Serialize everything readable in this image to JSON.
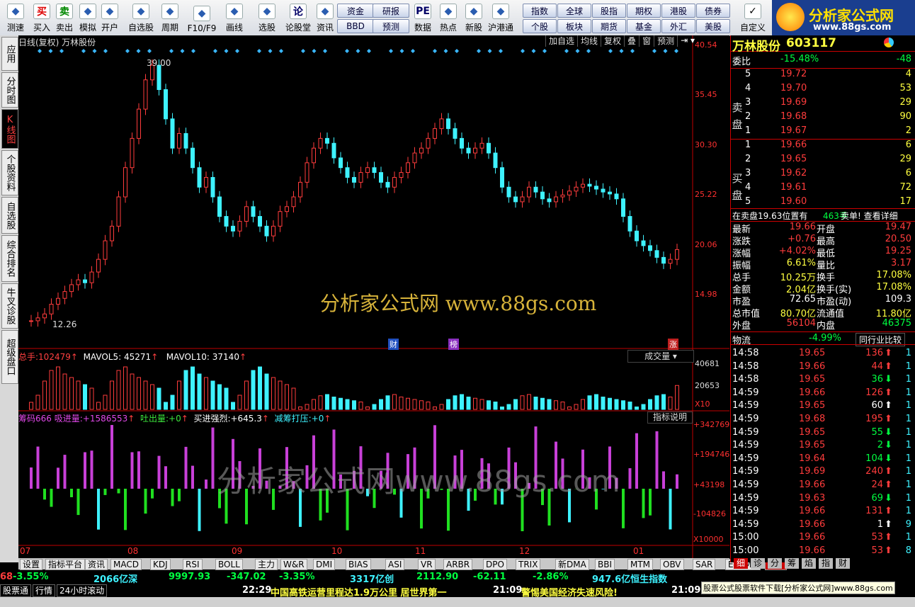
{
  "toolbar": {
    "buttons": [
      {
        "label": "测速",
        "icon": "clock-icon"
      },
      {
        "label": "买入",
        "icon": "buy-icon",
        "glyph": "买"
      },
      {
        "label": "卖出",
        "icon": "sell-icon",
        "glyph": "卖"
      },
      {
        "label": "模拟",
        "icon": "hammer-icon"
      },
      {
        "label": "开户",
        "icon": "lock-icon"
      },
      {
        "label": "自选股",
        "icon": "star-icon"
      },
      {
        "label": "周期",
        "icon": "cycle-icon"
      },
      {
        "label": "F10/F9",
        "icon": "f10-icon"
      },
      {
        "label": "画线",
        "icon": "pencil-icon"
      },
      {
        "label": "选股",
        "icon": "picker-icon"
      },
      {
        "label": "论股堂",
        "icon": "discuss-icon",
        "glyph": "论"
      },
      {
        "label": "资讯",
        "icon": "news-icon"
      },
      {
        "label": "数据",
        "icon": "pe-icon",
        "glyph": "PE"
      },
      {
        "label": "热点",
        "icon": "hot-icon"
      },
      {
        "label": "新股",
        "icon": "ipo-icon"
      },
      {
        "label": "沪港通",
        "icon": "hk-icon"
      }
    ],
    "quick_left": [
      "资金",
      "研报",
      "BBD",
      "预测"
    ],
    "quick_right": [
      "指数",
      "全球",
      "股指",
      "期权",
      "港股",
      "债券",
      "个股",
      "板块",
      "期货",
      "基金",
      "外汇",
      "美股"
    ],
    "custom_label": "自定义",
    "logo_text": "分析家公式网",
    "logo_url": "www.88gs.com"
  },
  "left_tabs": [
    "应用",
    "分时图",
    "K线图",
    "个股资料",
    "自选股",
    "综合排名",
    "牛叉诊股",
    "超级盘口"
  ],
  "chart": {
    "title": "日线(复权)  万林股份",
    "top_buttons": [
      "加自选",
      "均线",
      "复权",
      "叠",
      "窗",
      "预测"
    ],
    "price_axis": [
      "40.54",
      "35.45",
      "30.30",
      "25.22",
      "20.06",
      "14.98"
    ],
    "high_label": "39.00",
    "low_label": "12.26",
    "watermark": "分析家公式网  www.88gs.com",
    "markers": [
      "财",
      "榜",
      "涨"
    ],
    "vol_header": {
      "zs_label": "总手:",
      "zs_value": "102479",
      "ma5_label": "MAVOL5:",
      "ma5_value": "45271",
      "ma10_label": "MAVOL10:",
      "ma10_value": "37140"
    },
    "vol_dropdown": "成交量",
    "vol_axis": [
      "40681",
      "20653",
      "X10"
    ],
    "ind_header": {
      "name": "筹码666",
      "a_label": "吸进量:",
      "a_value": "+1586553",
      "b_label": "吐出量:",
      "b_value": "+0",
      "c_label": "买进强烈:",
      "c_value": "+645.3",
      "d_label": "减筹打压:",
      "d_value": "+0"
    },
    "ind_button": "指标说明",
    "ind_axis": [
      "+342769",
      "+194746",
      "+43198",
      "-104826",
      "X10000"
    ],
    "ind_watermark": "分析家公式网www.88gs.com",
    "month_labels": [
      "07",
      "08",
      "09",
      "10",
      "11",
      "12",
      "01"
    ]
  },
  "quote": {
    "name": "万林股份",
    "code": "603117",
    "weibi_label": "委比",
    "weibi_value": "-15.48%",
    "weicha_value": "-48",
    "sell_label": "卖盘",
    "buy_label": "买盘",
    "sell": [
      {
        "lvl": "5",
        "price": "19.72",
        "vol": "4"
      },
      {
        "lvl": "4",
        "price": "19.70",
        "vol": "53"
      },
      {
        "lvl": "3",
        "price": "19.69",
        "vol": "29"
      },
      {
        "lvl": "2",
        "price": "19.68",
        "vol": "90"
      },
      {
        "lvl": "1",
        "price": "19.67",
        "vol": "2"
      }
    ],
    "buy": [
      {
        "lvl": "1",
        "price": "19.66",
        "vol": "6"
      },
      {
        "lvl": "2",
        "price": "19.65",
        "vol": "29"
      },
      {
        "lvl": "3",
        "price": "19.62",
        "vol": "6"
      },
      {
        "lvl": "4",
        "price": "19.61",
        "vol": "72"
      },
      {
        "lvl": "5",
        "price": "19.60",
        "vol": "17"
      }
    ],
    "pos_text_a": "在卖盘19.63位置有",
    "pos_vol": "463手",
    "pos_text_b": "卖单! 查看详细",
    "stats": [
      {
        "l1": "最新",
        "v1": "19.66",
        "c1": "red",
        "l2": "开盘",
        "v2": "19.47",
        "c2": "red"
      },
      {
        "l1": "涨跌",
        "v1": "+0.76",
        "c1": "red",
        "l2": "最高",
        "v2": "20.50",
        "c2": "red"
      },
      {
        "l1": "涨幅",
        "v1": "+4.02%",
        "c1": "red",
        "l2": "最低",
        "v2": "19.25",
        "c2": "red"
      },
      {
        "l1": "振幅",
        "v1": "6.61%",
        "c1": "yellow",
        "l2": "量比",
        "v2": "3.17",
        "c2": "red"
      },
      {
        "l1": "总手",
        "v1": "10.25万",
        "c1": "yellow",
        "l2": "换手",
        "v2": "17.08%",
        "c2": "yellow"
      },
      {
        "l1": "金额",
        "v1": "2.04亿",
        "c1": "yellow",
        "l2": "换手(实)",
        "v2": "17.08%",
        "c2": "yellow"
      },
      {
        "l1": "市盈",
        "v1": "72.65",
        "c1": "white",
        "l2": "市盈(动)",
        "v2": "109.3",
        "c2": "white"
      },
      {
        "l1": "总市值",
        "v1": "80.70亿",
        "c1": "yellow",
        "l2": "流通值",
        "v2": "11.80亿",
        "c2": "yellow"
      },
      {
        "l1": "外盘",
        "v1": "56104",
        "c1": "red",
        "l2": "内盘",
        "v2": "46375",
        "c2": "green"
      }
    ],
    "industry_label": "物流",
    "industry_value": "-4.99%",
    "industry_btn": "同行业比较",
    "ticks": [
      {
        "t": "14:58",
        "p": "19.65",
        "v": "136",
        "d": "up",
        "n": "1"
      },
      {
        "t": "14:58",
        "p": "19.66",
        "v": "44",
        "d": "up",
        "n": "1"
      },
      {
        "t": "14:58",
        "p": "19.65",
        "v": "36",
        "d": "down",
        "n": "1"
      },
      {
        "t": "14:59",
        "p": "19.66",
        "v": "126",
        "d": "up",
        "n": "1"
      },
      {
        "t": "14:59",
        "p": "19.65",
        "v": "60",
        "d": "neutral",
        "n": "1"
      },
      {
        "t": "14:59",
        "p": "19.68",
        "v": "195",
        "d": "up",
        "n": "1"
      },
      {
        "t": "14:59",
        "p": "19.65",
        "v": "55",
        "d": "down",
        "n": "1"
      },
      {
        "t": "14:59",
        "p": "19.65",
        "v": "2",
        "d": "down",
        "n": "1"
      },
      {
        "t": "14:59",
        "p": "19.64",
        "v": "104",
        "d": "down",
        "n": "1"
      },
      {
        "t": "14:59",
        "p": "19.69",
        "v": "240",
        "d": "up",
        "n": "1"
      },
      {
        "t": "14:59",
        "p": "19.66",
        "v": "24",
        "d": "up",
        "n": "1"
      },
      {
        "t": "14:59",
        "p": "19.63",
        "v": "69",
        "d": "down",
        "n": "1"
      },
      {
        "t": "14:59",
        "p": "19.66",
        "v": "131",
        "d": "up",
        "n": "1"
      },
      {
        "t": "14:59",
        "p": "19.66",
        "v": "1",
        "d": "neutral",
        "n": "9"
      },
      {
        "t": "15:00",
        "p": "19.66",
        "v": "53",
        "d": "up",
        "n": "1"
      },
      {
        "t": "15:00",
        "p": "19.66",
        "v": "53",
        "d": "up",
        "n": "8"
      }
    ],
    "bottom_tabs": [
      "细",
      "诊",
      "分",
      "筹",
      "焰",
      "指",
      "财"
    ]
  },
  "bottom_tabs": [
    "设置",
    "指标平台",
    "资讯",
    "MACD",
    "KDJ",
    "RSI",
    "BOLL",
    "主力",
    "W&R",
    "DMI",
    "BIAS",
    "ASI",
    "VR",
    "ARBR",
    "DPO",
    "TRIX",
    "新DMA",
    "BBI",
    "MTM",
    "OBV",
    "SAR",
    "EXPMA",
    "筹码666"
  ],
  "status1": [
    {
      "text": "68",
      "c": "red"
    },
    {
      "text": "-3.55%",
      "c": "green"
    },
    {
      "text": "2066亿深",
      "c": "cyan"
    },
    {
      "text": "9997.93",
      "c": "green"
    },
    {
      "text": "-347.02",
      "c": "green"
    },
    {
      "text": "-3.35%",
      "c": "green"
    },
    {
      "text": "3317亿创",
      "c": "cyan"
    },
    {
      "text": "2112.90",
      "c": "green"
    },
    {
      "text": "-62.11",
      "c": "green"
    },
    {
      "text": "-2.86%",
      "c": "green"
    },
    {
      "text": "947.6亿恒生指数",
      "c": "cyan"
    }
  ],
  "status2": {
    "left": [
      "股票通",
      "行情",
      "24小时滚动"
    ],
    "news1_time": "22:29",
    "news1": "中国高铁运营里程达1.9万公里 居世界第一",
    "news2_time": "21:09",
    "news2": "警惕美国经济失速风险!",
    "news3_time": "21:09",
    "ad": "股票公式股票软件下载[分析家公式网]www.88gs.com"
  },
  "colors": {
    "up": "#ff3c3c",
    "down": "#3ef2ff",
    "ind_pos": "#c840d8",
    "ind_neg": "#20e020",
    "axis": "#ff3030",
    "border": "#c00000"
  }
}
